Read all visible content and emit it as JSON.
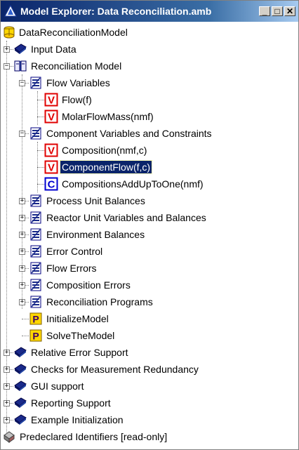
{
  "window": {
    "title": "Model Explorer: Data Reconciliation.amb",
    "minimize_glyph": "_",
    "maximize_glyph": "□",
    "close_glyph": "✕"
  },
  "tree": {
    "root": "DataReconciliationModel",
    "nodes": [
      {
        "label": "Input Data",
        "icon": "book-icon"
      },
      {
        "label": "Reconciliation Model",
        "icon": "open-book-icon"
      },
      {
        "label": "Flow Variables",
        "icon": "declaration-section-icon"
      },
      {
        "label": "Flow(f)",
        "icon": "variable-icon"
      },
      {
        "label": "MolarFlowMass(nmf)",
        "icon": "variable-icon"
      },
      {
        "label": "Component Variables and Constraints",
        "icon": "declaration-section-icon"
      },
      {
        "label": "Composition(nmf,c)",
        "icon": "variable-icon"
      },
      {
        "label": "ComponentFlow(f,c)",
        "icon": "variable-icon",
        "selected": true
      },
      {
        "label": "CompositionsAddUpToOne(nmf)",
        "icon": "constraint-icon"
      },
      {
        "label": "Process Unit Balances",
        "icon": "declaration-section-icon"
      },
      {
        "label": "Reactor Unit Variables and Balances",
        "icon": "declaration-section-icon"
      },
      {
        "label": "Environment Balances",
        "icon": "declaration-section-icon"
      },
      {
        "label": "Error Control",
        "icon": "declaration-section-icon"
      },
      {
        "label": "Flow Errors",
        "icon": "declaration-section-icon"
      },
      {
        "label": "Composition Errors",
        "icon": "declaration-section-icon"
      },
      {
        "label": "Reconciliation Programs",
        "icon": "declaration-section-icon"
      },
      {
        "label": "InitializeModel",
        "icon": "procedure-icon"
      },
      {
        "label": "SolveTheModel",
        "icon": "procedure-icon"
      },
      {
        "label": "Relative Error Support",
        "icon": "book-icon"
      },
      {
        "label": "Checks for Measurement Redundancy",
        "icon": "book-icon"
      },
      {
        "label": "GUI support",
        "icon": "book-icon"
      },
      {
        "label": "Reporting Support",
        "icon": "book-icon"
      },
      {
        "label": "Example Initialization",
        "icon": "book-icon"
      },
      {
        "label": "Predeclared Identifiers [read-only]",
        "icon": "predeclared-icon"
      }
    ]
  },
  "colors": {
    "title_bar": "#0a246a",
    "selection": "#0a246a",
    "variable_red": "#e00000",
    "constraint_blue": "#0000d0",
    "procedure_yellow": "#ffd700"
  }
}
